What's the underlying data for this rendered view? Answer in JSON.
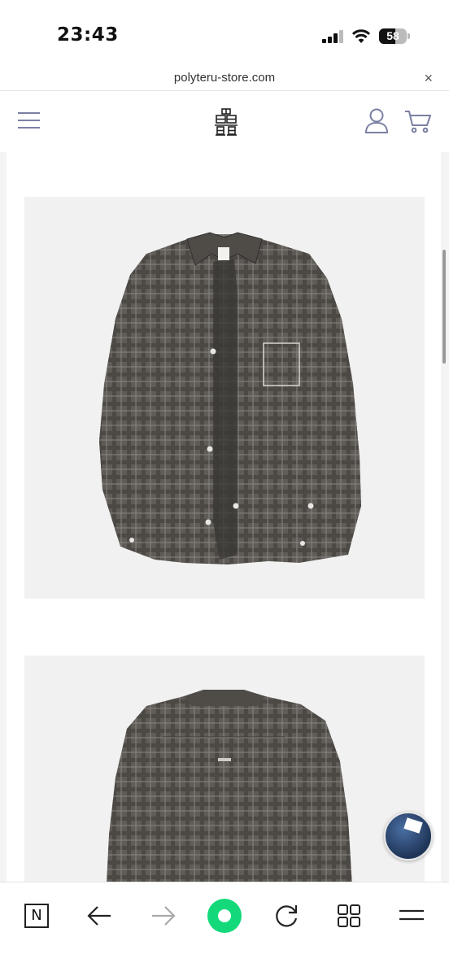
{
  "status_bar": {
    "time": "23:43",
    "battery_level": "58",
    "icons": [
      "signal-icon",
      "wifi-icon",
      "battery-icon"
    ]
  },
  "browser": {
    "url": "polyteru-store.com",
    "close_glyph": "×"
  },
  "site_header": {
    "icons": [
      "menu-icon",
      "brand-logo",
      "account-icon",
      "cart-icon"
    ]
  },
  "products": [
    {
      "image": "checked-shirt-front-photo"
    },
    {
      "image": "checked-shirt-back-photo"
    }
  ],
  "chat_widget": {
    "icon": "chat-avatar"
  },
  "toolbar": {
    "n_label": "N",
    "buttons": [
      "naver-n-button",
      "back-arrow-icon",
      "forward-arrow-icon",
      "home-green-icon",
      "reload-icon",
      "tabs-grid-icon",
      "menu-lines-icon"
    ]
  },
  "colors": {
    "header_icon": "#7a7fa3",
    "home_green": "#14d97b",
    "image_bg": "#f1f1f1",
    "shirt_fabric": "#5f5c57"
  }
}
